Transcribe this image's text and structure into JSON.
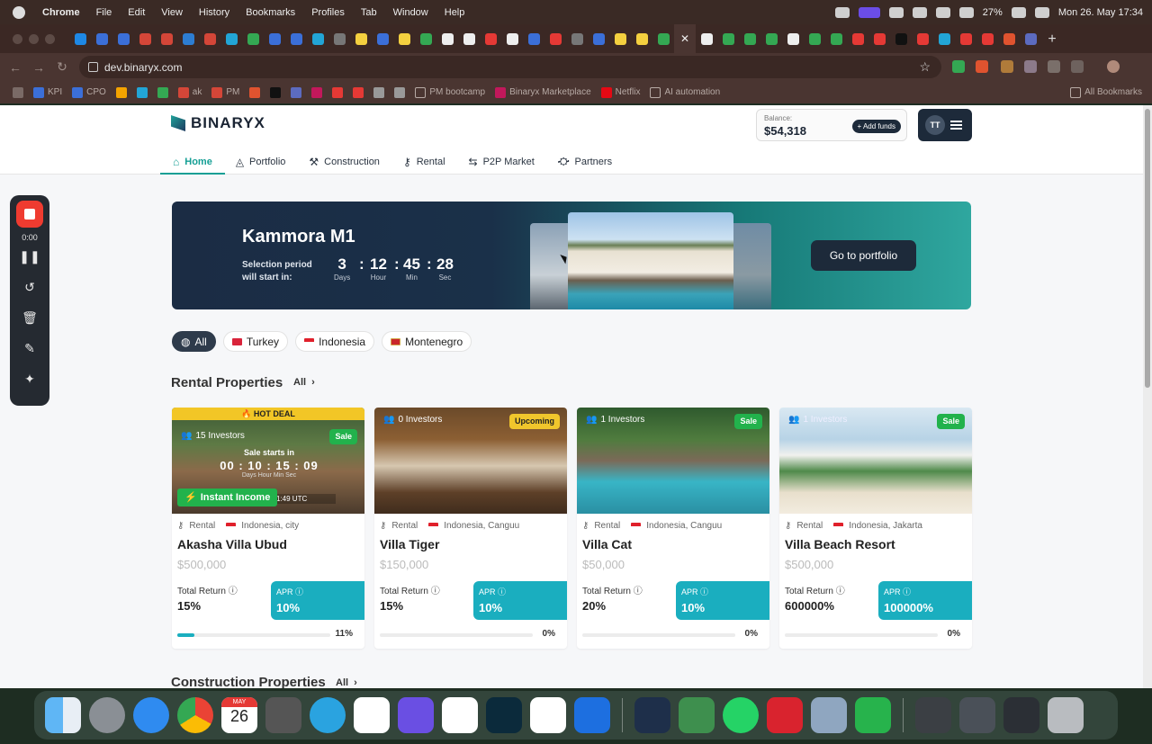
{
  "menubar": {
    "app": "Chrome",
    "items": [
      "File",
      "Edit",
      "View",
      "History",
      "Bookmarks",
      "Profiles",
      "Tab",
      "Window",
      "Help"
    ],
    "battery": "27%",
    "datetime": "Mon 26. May  17:34"
  },
  "browser": {
    "url": "dev.binaryx.com",
    "bookmarks": [
      "KPI",
      "CPO",
      "ak",
      "PM",
      "PM bootcamp",
      "Binaryx Marketplace",
      "Netflix",
      "AI automation"
    ],
    "all_bookmarks": "All Bookmarks"
  },
  "header": {
    "brand": "BINARYX",
    "balance_label": "Balance:",
    "balance_value": "$54,318",
    "add_funds": "+ Add funds",
    "user_initials": "TT"
  },
  "nav": {
    "items": [
      {
        "label": "Home",
        "icon": "home-icon",
        "active": true
      },
      {
        "label": "Portfolio",
        "icon": "portfolio-icon"
      },
      {
        "label": "Construction",
        "icon": "construction-icon"
      },
      {
        "label": "Rental",
        "icon": "key-icon"
      },
      {
        "label": "P2P Market",
        "icon": "swap-icon"
      },
      {
        "label": "Partners",
        "icon": "handshake-icon"
      }
    ]
  },
  "recorder": {
    "time": "0:00"
  },
  "banner": {
    "title": "Kammora M1",
    "selection_line1": "Selection period",
    "selection_line2": "will start in:",
    "countdown": [
      {
        "value": "3",
        "unit": "Days"
      },
      {
        "value": "12",
        "unit": "Hour"
      },
      {
        "value": "45",
        "unit": "Min"
      },
      {
        "value": "28",
        "unit": "Sec"
      }
    ],
    "cta": "Go to portfolio"
  },
  "filters": [
    "All",
    "Turkey",
    "Indonesia",
    "Montenegro"
  ],
  "rental_section": {
    "title": "Rental Properties",
    "all": "All"
  },
  "construction_section": {
    "title": "Construction Properties",
    "all": "All"
  },
  "cards": [
    {
      "hot_deal": "🔥 HOT DEAL",
      "investors": "15 Investors",
      "badge": "Sale",
      "sale_starts": "Sale starts in",
      "timer": "00 : 10 : 15 : 09",
      "timer_units": "Days   Hour   Min   Sec",
      "instant": "Instant Income",
      "utc": "1:49 UTC",
      "type": "Rental",
      "location": "Indonesia, city",
      "name": "Akasha Villa Ubud",
      "price": "$500,000",
      "total_return_label": "Total Return",
      "total_return": "15%",
      "apr_label": "APR",
      "apr": "10%",
      "progress": 0.11,
      "progress_text": "11%"
    },
    {
      "investors": "0 Investors",
      "badge": "Upcoming",
      "type": "Rental",
      "location": "Indonesia, Canguu",
      "name": "Villa Tiger",
      "price": "$150,000",
      "total_return_label": "Total Return",
      "total_return": "15%",
      "apr_label": "APR",
      "apr": "10%",
      "progress": 0,
      "progress_text": "0%"
    },
    {
      "investors": "1 Investors",
      "badge": "Sale",
      "type": "Rental",
      "location": "Indonesia, Canguu",
      "name": "Villa Cat",
      "price": "$50,000",
      "total_return_label": "Total Return",
      "total_return": "20%",
      "apr_label": "APR",
      "apr": "10%",
      "progress": 0,
      "progress_text": "0%"
    },
    {
      "investors": "1 Investors",
      "badge": "Sale",
      "type": "Rental",
      "location": "Indonesia, Jakarta",
      "name": "Villa Beach Resort",
      "price": "$500,000",
      "total_return_label": "Total Return",
      "total_return": "600000%",
      "apr_label": "APR",
      "apr": "100000%",
      "progress": 0,
      "progress_text": "0%"
    }
  ],
  "dock": {
    "calendar_month": "MAY",
    "calendar_day": "26"
  },
  "colors": {
    "accent": "#159f95",
    "apr": "#1aaebf",
    "dark": "#1d2a3a",
    "sale": "#22b24c",
    "upcoming": "#f0c62c"
  }
}
